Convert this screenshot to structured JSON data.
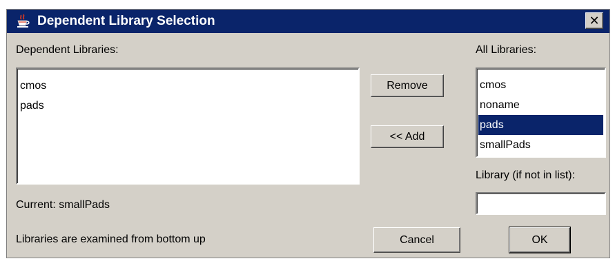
{
  "window": {
    "title": "Dependent Library Selection",
    "close_label": "✕",
    "icon": "java-cup-icon"
  },
  "dependent_libraries": {
    "label": "Dependent Libraries:",
    "items": [
      "cmos",
      "pads"
    ]
  },
  "buttons": {
    "remove": "Remove",
    "add": "<< Add",
    "cancel": "Cancel",
    "ok": "OK"
  },
  "all_libraries": {
    "label": "All Libraries:",
    "items": [
      "cmos",
      "noname",
      "pads",
      "smallPads"
    ],
    "selected": "pads"
  },
  "library_input": {
    "label": "Library (if not in list):",
    "value": ""
  },
  "current": "Current: smallPads",
  "note": "Libraries are examined from bottom up",
  "colors": {
    "titlebar": "#0a246a",
    "dialog_bg": "#d4d0c8",
    "selection": "#0a246a"
  }
}
